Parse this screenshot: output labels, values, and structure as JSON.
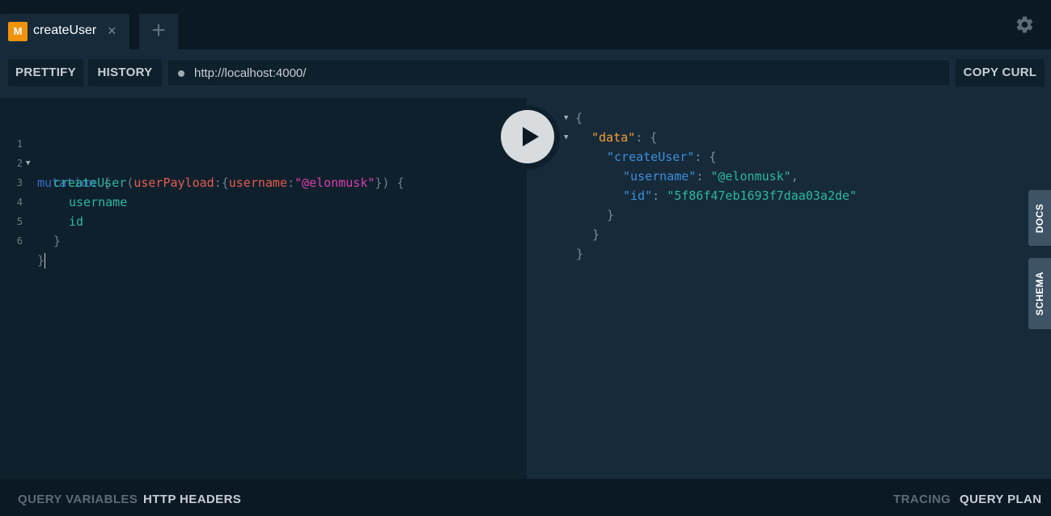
{
  "tabs": [
    {
      "badge": "M",
      "title": "createUser",
      "close": "×"
    }
  ],
  "new_tab": "+",
  "settings_icon": "gear-icon",
  "toolbar": {
    "prettify": "PRETTIFY",
    "history": "HISTORY",
    "endpoint": "http://localhost:4000/",
    "copy_curl": "COPY CURL"
  },
  "editor": {
    "line_numbers": [
      "1",
      "2",
      "3",
      "4",
      "5",
      "6"
    ],
    "mutation_keyword": "mutation",
    "field": "createUser",
    "argument": "userPayload",
    "input_key": "username",
    "input_value": "\"@elonmusk\"",
    "selections": [
      "username",
      "id"
    ]
  },
  "result": {
    "data_key": "\"data\"",
    "create_user_key": "\"createUser\"",
    "username_key": "\"username\"",
    "username_value": "\"@elonmusk\"",
    "id_key": "\"id\"",
    "id_value": "\"5f86f47eb1693f7daa03a2de\""
  },
  "side_tabs": {
    "docs": "DOCS",
    "schema": "SCHEMA"
  },
  "bottom": {
    "query_variables": "QUERY VARIABLES",
    "http_headers": "HTTP HEADERS",
    "tracing": "TRACING",
    "query_plan": "QUERY PLAN"
  },
  "colors": {
    "background": "#0f202d",
    "panel": "#172a3a",
    "badge": "#f0930c",
    "keyword": "#3d6dc9",
    "field": "#2bb89c",
    "argument": "#e45c4d",
    "string": "#d63faa",
    "data_key": "#f59e32"
  }
}
